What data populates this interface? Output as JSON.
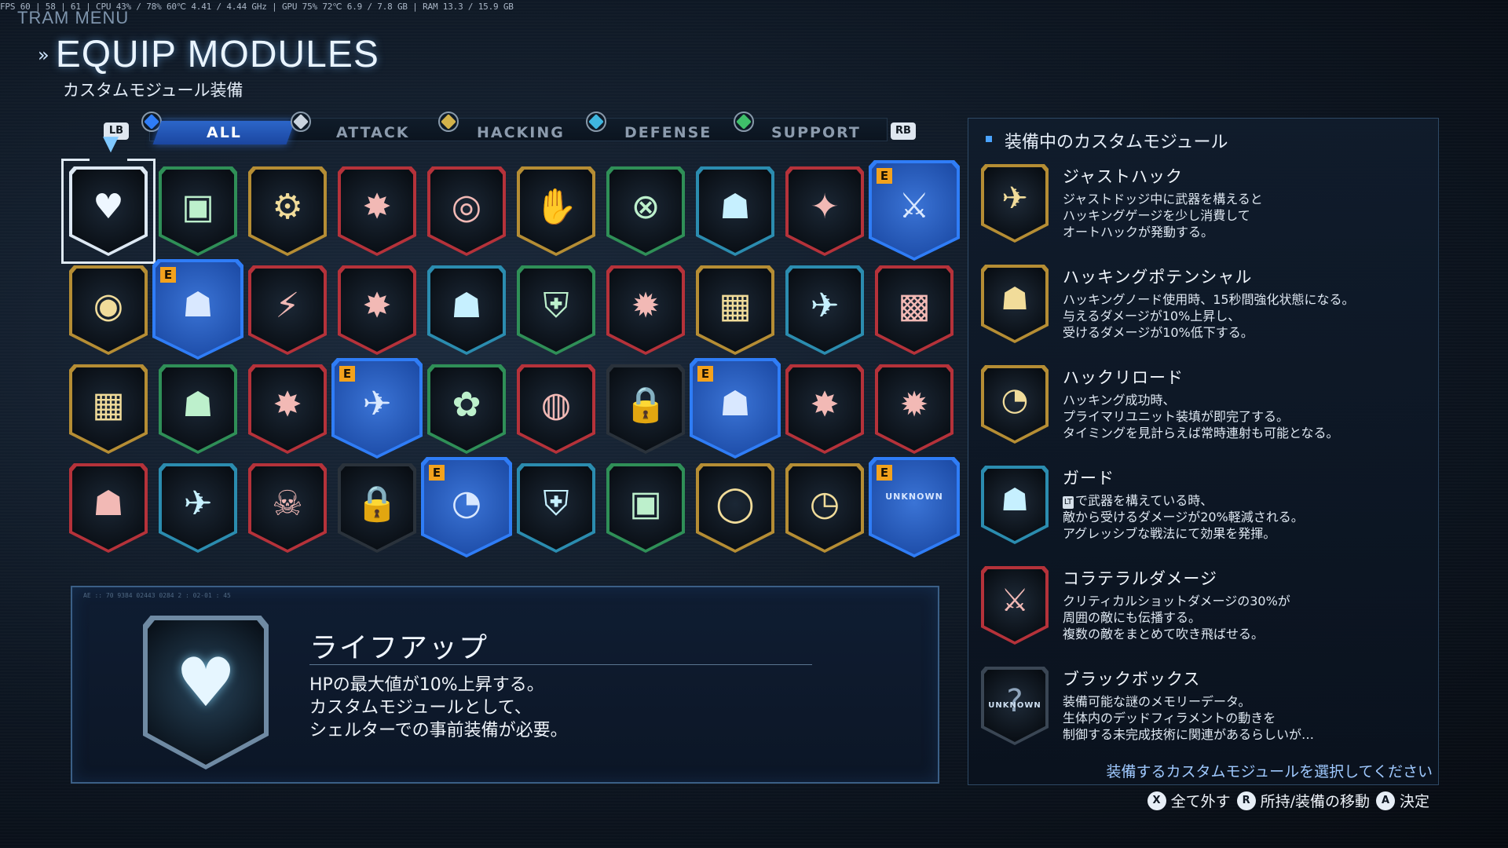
{
  "perf": {
    "text": "FPS 60 | 58 | 61 |  CPU 43% / 78%  60℃  4.41 / 4.44 GHz | GPU 75%  72℃  6.9 / 7.8 GB  |  RAM 13.3 / 15.9 GB"
  },
  "header": {
    "menu_title": "TRAM MENU",
    "title": "EQUIP MODULES",
    "subtitle": "カスタムモジュール装備"
  },
  "tabs": {
    "lb": "LB",
    "rb": "RB",
    "items": [
      {
        "label": "ALL",
        "active": true,
        "icon": "shield-icon"
      },
      {
        "label": "ATTACK",
        "active": false,
        "icon": "gun-icon"
      },
      {
        "label": "HACKING",
        "active": false,
        "icon": "chip-icon"
      },
      {
        "label": "DEFENSE",
        "active": false,
        "icon": "chevron-shield-icon"
      },
      {
        "label": "SUPPORT",
        "active": false,
        "icon": "signal-icon"
      }
    ]
  },
  "grid": {
    "rows": [
      [
        {
          "color": "white",
          "glyph": "♥",
          "icon": "heart-plus-icon",
          "selected": true
        },
        {
          "color": "green",
          "glyph": "▣",
          "icon": "armor-plus-icon"
        },
        {
          "color": "gold",
          "glyph": "⚙",
          "icon": "timer-figure-icon"
        },
        {
          "color": "red",
          "glyph": "✸",
          "icon": "robot-impact-icon"
        },
        {
          "color": "red",
          "glyph": "◎",
          "icon": "crosshair-icon"
        },
        {
          "color": "gold",
          "glyph": "✋",
          "icon": "hand-figure-icon"
        },
        {
          "color": "green",
          "glyph": "⊗",
          "icon": "target-cross-icon"
        },
        {
          "color": "cyan",
          "glyph": "☗",
          "icon": "soldier-hack-icon"
        },
        {
          "color": "red",
          "glyph": "✦",
          "icon": "explosion-figure-icon"
        },
        {
          "color": "blue",
          "glyph": "⚔",
          "icon": "collateral-icon",
          "equipped": true
        }
      ],
      [
        {
          "color": "gold",
          "glyph": "◉",
          "icon": "ring-icon"
        },
        {
          "color": "blue",
          "glyph": "☗",
          "icon": "hacking-potential-icon",
          "equipped": true
        },
        {
          "color": "red",
          "glyph": "⚡",
          "icon": "melee-icon"
        },
        {
          "color": "red",
          "glyph": "✸",
          "icon": "blast-icon"
        },
        {
          "color": "cyan",
          "glyph": "☗",
          "icon": "shoot-figure-icon"
        },
        {
          "color": "green",
          "glyph": "⛨",
          "icon": "shield-grid-icon"
        },
        {
          "color": "red",
          "glyph": "✹",
          "icon": "gun-blast-icon"
        },
        {
          "color": "gold",
          "glyph": "▦",
          "icon": "grid-box-icon"
        },
        {
          "color": "cyan",
          "glyph": "✈",
          "icon": "dodge-icon"
        },
        {
          "color": "red",
          "glyph": "▩",
          "icon": "gun-block-icon"
        }
      ],
      [
        {
          "color": "gold",
          "glyph": "▦",
          "icon": "gun-grid-icon"
        },
        {
          "color": "green",
          "glyph": "☗",
          "icon": "throw-figure-icon"
        },
        {
          "color": "red",
          "glyph": "✸",
          "icon": "kick-icon"
        },
        {
          "color": "blue",
          "glyph": "✈",
          "icon": "just-hack-icon",
          "equipped": true
        },
        {
          "color": "green",
          "glyph": "✿",
          "icon": "cylinder-icon"
        },
        {
          "color": "red",
          "glyph": "◍",
          "icon": "bullet-ring-icon"
        },
        {
          "color": "grey",
          "glyph": "🔒",
          "icon": "lock-icon"
        },
        {
          "color": "blue",
          "glyph": "☗",
          "icon": "guard-icon",
          "equipped": true
        },
        {
          "color": "red",
          "glyph": "✸",
          "icon": "blade-figure-icon"
        },
        {
          "color": "red",
          "glyph": "✹",
          "icon": "heavy-figure-icon"
        }
      ],
      [
        {
          "color": "red",
          "glyph": "☗",
          "icon": "hp-figure-icon"
        },
        {
          "color": "cyan",
          "glyph": "✈",
          "icon": "dash-timer-icon"
        },
        {
          "color": "red",
          "glyph": "☠",
          "icon": "target-figure-icon"
        },
        {
          "color": "grey",
          "glyph": "🔒",
          "icon": "lock-icon"
        },
        {
          "color": "blue",
          "glyph": "◔",
          "icon": "hack-reload-icon",
          "equipped": true
        },
        {
          "color": "cyan",
          "glyph": "⛨",
          "icon": "arrow-shield-icon"
        },
        {
          "color": "green",
          "glyph": "▣",
          "icon": "armor-stack-icon"
        },
        {
          "color": "gold",
          "glyph": "◯",
          "icon": "reload-ring-icon"
        },
        {
          "color": "gold",
          "glyph": "◷",
          "icon": "clock-icon"
        },
        {
          "color": "blue",
          "glyph": "",
          "icon": "unknown-icon",
          "equipped": true,
          "label": "UNKNOWN"
        }
      ]
    ],
    "equipped_badge": "E"
  },
  "detail": {
    "tiny_text": "AE :: 70 9384 02443 0284 2 : 02-01 : 45",
    "name": "ライフアップ",
    "desc": [
      "HPの最大値が10%上昇する。",
      "カスタムモジュールとして、",
      "シェルターでの事前装備が必要。"
    ]
  },
  "equipped_panel": {
    "title": "装備中のカスタムモジュール",
    "entries": [
      {
        "name": "ジャストハック",
        "color": "gold",
        "glyph": "✈",
        "icon": "just-hack-icon",
        "desc": [
          "ジャストドッジ中に武器を構えると",
          "ハッキングゲージを少し消費して",
          "オートハックが発動する。"
        ]
      },
      {
        "name": "ハッキングポテンシャル",
        "color": "gold",
        "glyph": "☗",
        "icon": "hacking-potential-icon",
        "desc": [
          "ハッキングノード使用時、15秒間強化状態になる。",
          "与えるダメージが10%上昇し、",
          "受けるダメージが10%低下する。"
        ]
      },
      {
        "name": "ハックリロード",
        "color": "gold",
        "glyph": "◔",
        "icon": "hack-reload-icon",
        "desc": [
          "ハッキング成功時、",
          "プライマリユニット装填が即完了する。",
          "タイミングを見計らえば常時連射も可能となる。"
        ]
      },
      {
        "name": "ガード",
        "color": "cyan",
        "glyph": "☗",
        "icon": "guard-icon",
        "kbd": "LT",
        "desc": [
          "で武器を構えている時、",
          "敵から受けるダメージが20%軽減される。",
          "アグレッシブな戦法にて効果を発揮。"
        ]
      },
      {
        "name": "コラテラルダメージ",
        "color": "red",
        "glyph": "⚔",
        "icon": "collateral-icon",
        "desc": [
          "クリティカルショットダメージの30%が",
          "周囲の敵にも伝播する。",
          "複数の敵をまとめて吹き飛ばせる。"
        ]
      },
      {
        "name": "ブラックボックス",
        "color": "grey",
        "glyph": "?",
        "icon": "unknown-icon",
        "unknown_label": "UNKNOWN",
        "desc": [
          "装備可能な謎のメモリーデータ。",
          "生体内のデッドフィラメントの動きを",
          "制御する未完成技術に関連があるらしいが…"
        ]
      }
    ]
  },
  "prompt": "装備するカスタムモジュールを選択してください",
  "footer": {
    "buttons": [
      {
        "key": "X",
        "label": "全て外す"
      },
      {
        "key": "R",
        "label": "所持/装備の移動"
      },
      {
        "key": "A",
        "label": "決定"
      }
    ]
  },
  "colors": {
    "accent": "#2f7df7",
    "equipped_badge": "#f3a21d",
    "attack": "#b5323a",
    "hacking": "#b58d34",
    "defense": "#2b8caf",
    "support": "#2f8f57"
  }
}
